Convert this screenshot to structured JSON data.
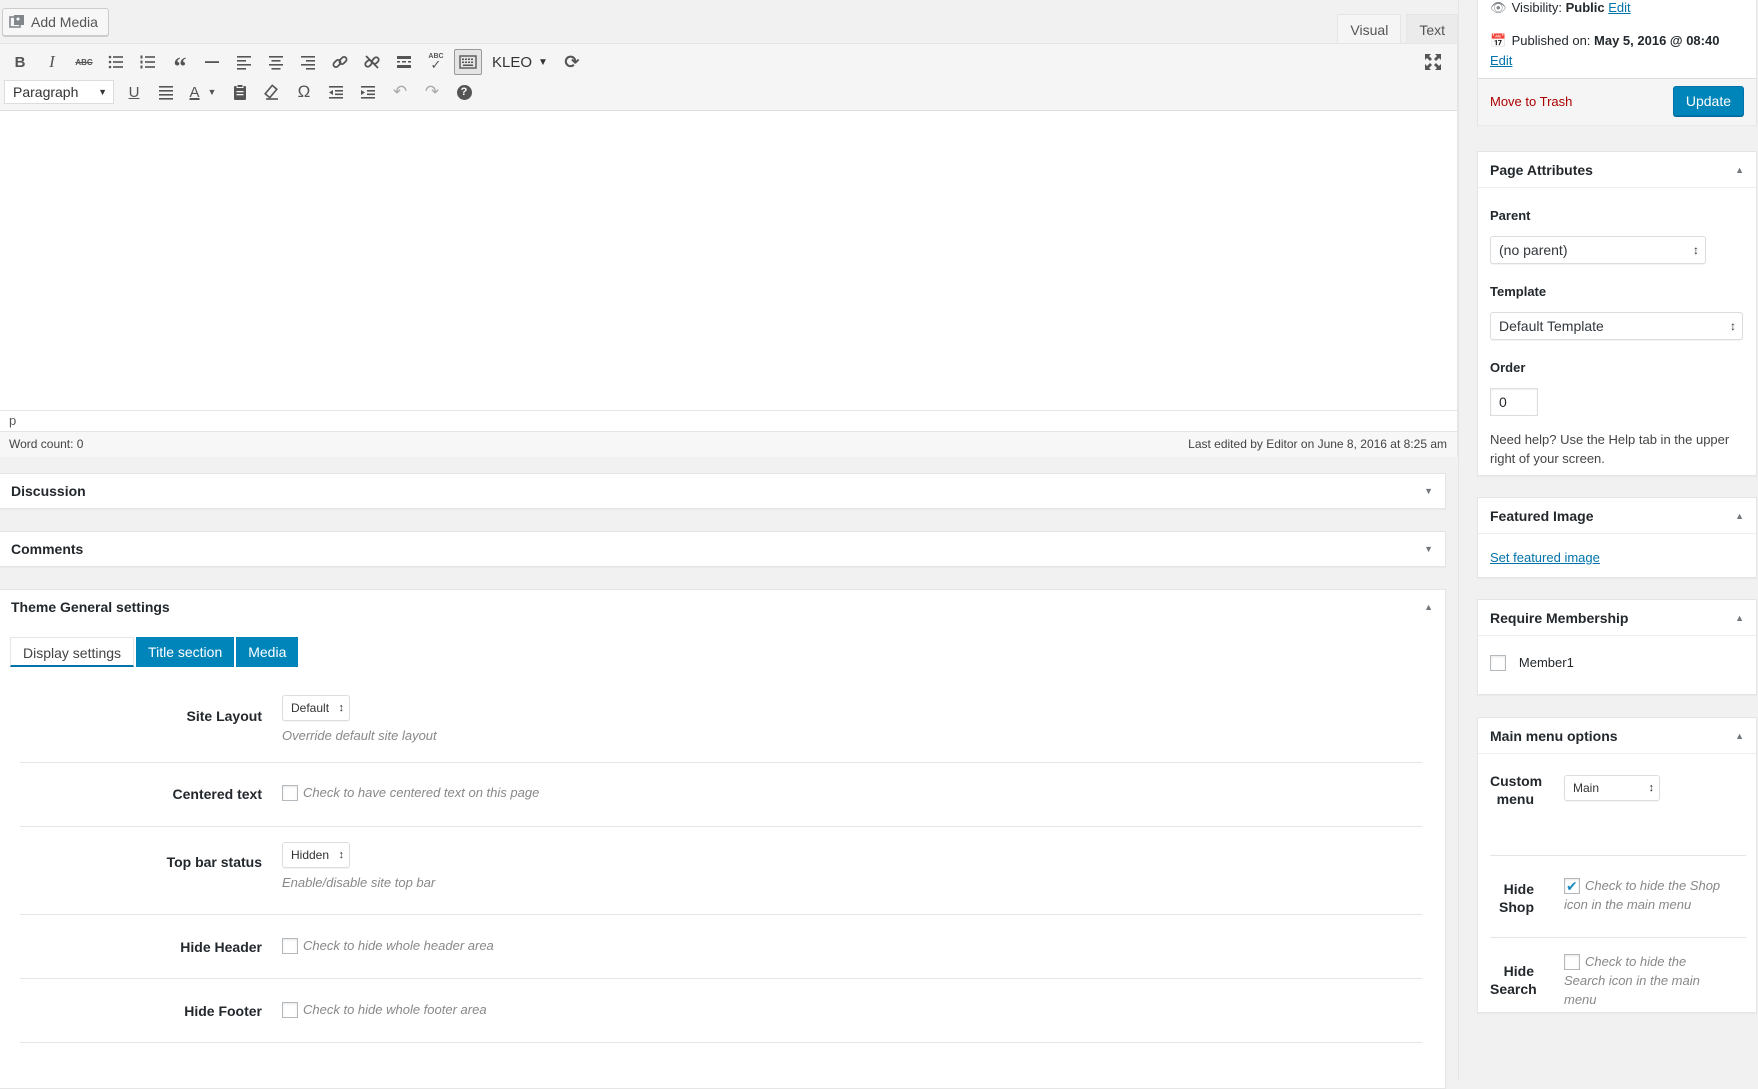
{
  "editor": {
    "add_media_label": "Add Media",
    "tabs": [
      "Visual",
      "Text"
    ],
    "active_tab": "Visual",
    "kleo_label": "KLEO",
    "format_select": "Paragraph",
    "path": "p",
    "word_count": "Word count: 0",
    "last_edited": "Last edited by Editor on June 8, 2016 at 8:25 am",
    "accent_color": "#0085ba"
  },
  "postboxes": {
    "discussion": "Discussion",
    "comments": "Comments",
    "theme_settings": "Theme General settings"
  },
  "theme_settings": {
    "tabs": [
      "Display settings",
      "Title section",
      "Media"
    ],
    "rows": {
      "site_layout": {
        "label": "Site Layout",
        "value": "Default",
        "desc": "Override default site layout"
      },
      "centered_text": {
        "label": "Centered text",
        "desc": "Check to have centered text on this page"
      },
      "top_bar": {
        "label": "Top bar status",
        "value": "Hidden",
        "desc": "Enable/disable site top bar"
      },
      "hide_header": {
        "label": "Hide Header",
        "desc": "Check to hide whole header area"
      },
      "hide_footer": {
        "label": "Hide Footer",
        "desc": "Check to hide whole footer area"
      }
    }
  },
  "publish": {
    "visibility_label": "Visibility:",
    "visibility_value": "Public",
    "visibility_edit": "Edit",
    "published_label": "Published on:",
    "published_value": "May 5, 2016 @ 08:40",
    "published_edit": "Edit",
    "trash": "Move to Trash",
    "update": "Update"
  },
  "page_attributes": {
    "title": "Page Attributes",
    "parent_label": "Parent",
    "parent_value": "(no parent)",
    "template_label": "Template",
    "template_value": "Default Template",
    "order_label": "Order",
    "order_value": "0",
    "help": "Need help? Use the Help tab in the upper right of your screen."
  },
  "featured_image": {
    "title": "Featured Image",
    "link": "Set featured image"
  },
  "membership": {
    "title": "Require Membership",
    "option": "Member1"
  },
  "main_menu": {
    "title": "Main menu options",
    "custom_menu_label_1": "Custom",
    "custom_menu_label_2": "menu",
    "custom_menu_value": "Main",
    "hide_shop_label_1": "Hide",
    "hide_shop_label_2": "Shop",
    "hide_shop_desc": "Check to hide the Shop icon in the main menu",
    "hide_search_label_1": "Hide",
    "hide_search_label_2": "Search",
    "hide_search_desc": "Check to hide the Search icon in the main menu"
  }
}
